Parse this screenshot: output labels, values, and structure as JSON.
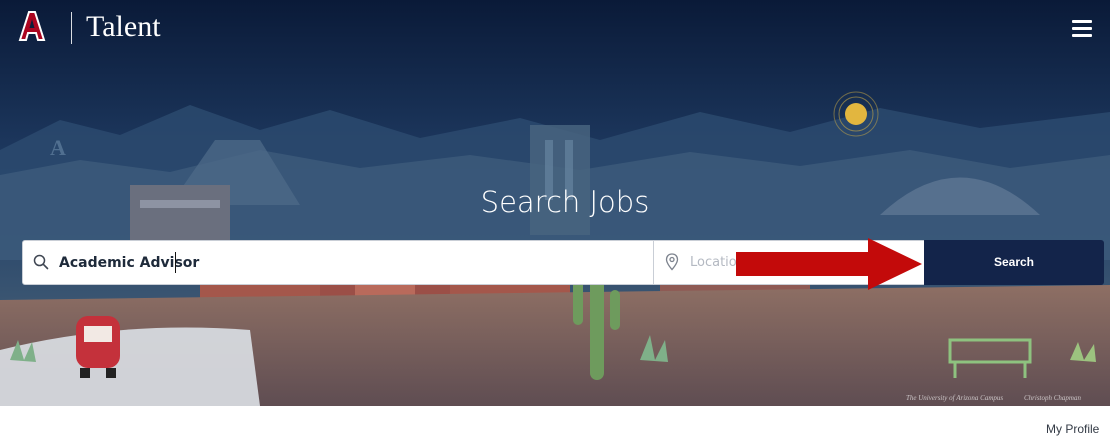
{
  "header": {
    "brand": "Talent",
    "menu_icon": "hamburger-menu-icon",
    "logo_icon": "university-block-a-logo"
  },
  "hero": {
    "title": "Search Jobs",
    "credit_left": "The University of Arizona Campus",
    "credit_right": "Christoph Chapman"
  },
  "search": {
    "keyword_value": "Academic Advisor",
    "location_placeholder": "Location",
    "button_label": "Search"
  },
  "annotation": {
    "arrow_color": "#c30a0a"
  },
  "footer": {
    "profile_link": "My Profile"
  },
  "colors": {
    "hero_dark": "#0c1d3a",
    "button_navy": "#13244a",
    "brand_red": "#ab0520"
  }
}
